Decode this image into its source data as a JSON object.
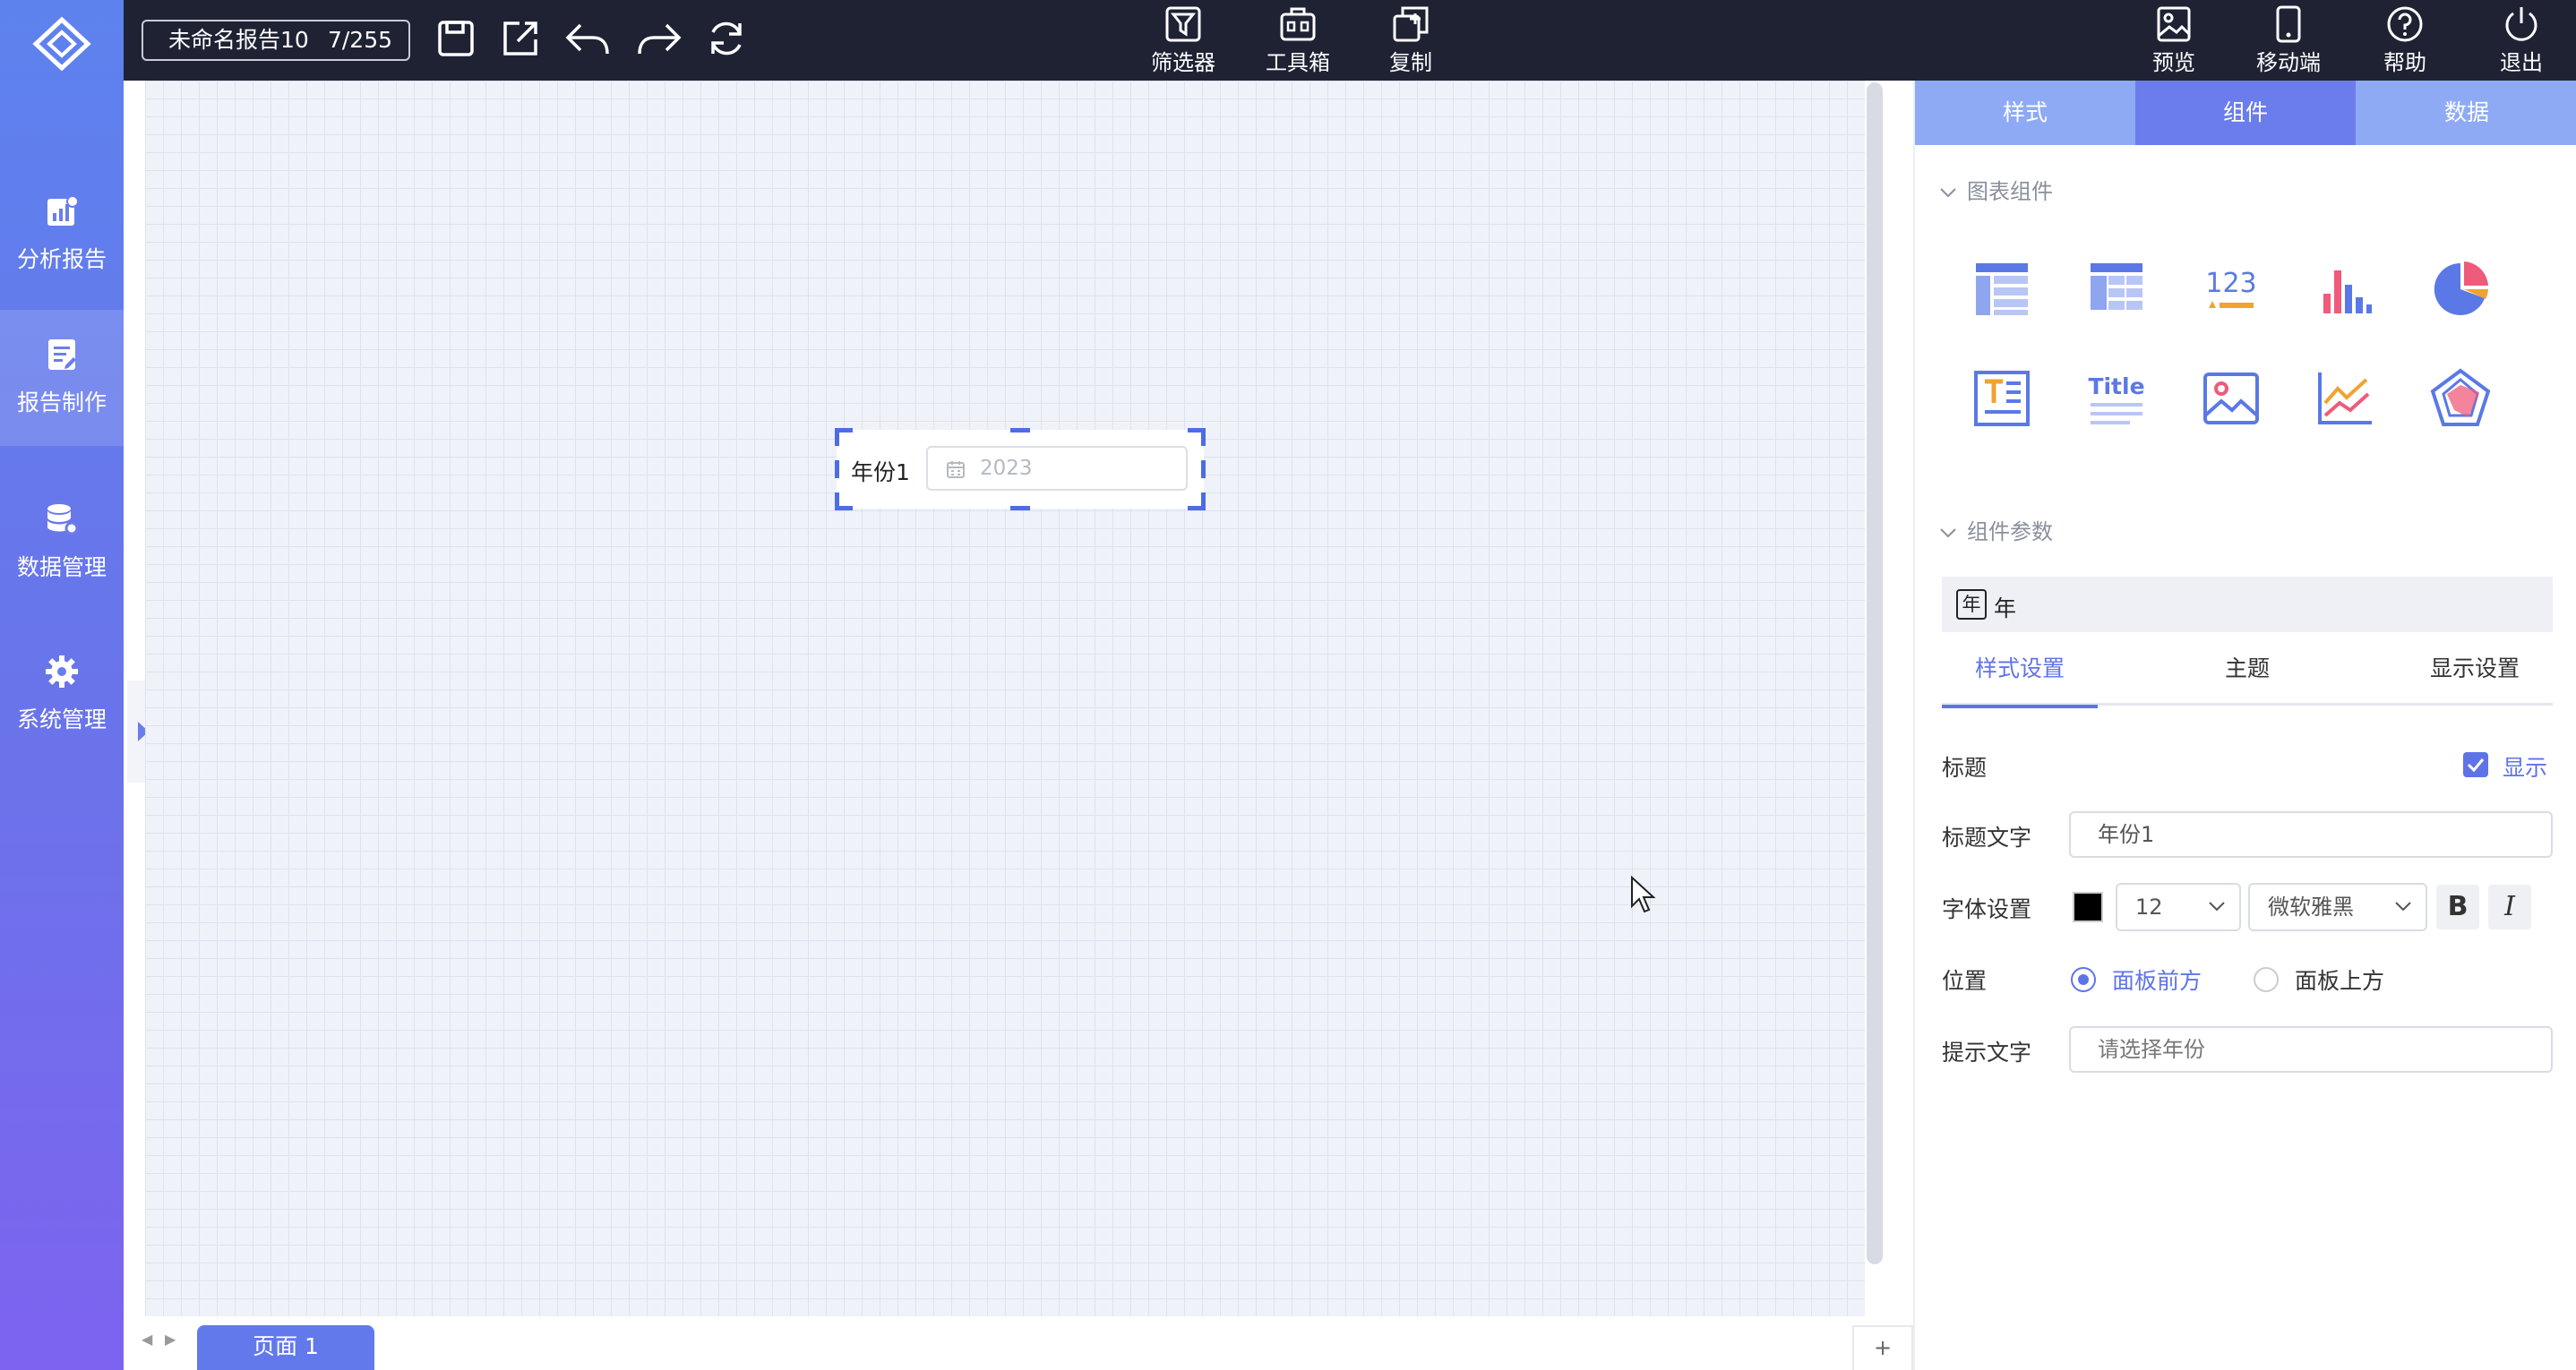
{
  "sidebar": {
    "items": [
      {
        "label": "分析报告",
        "icon": "report-chart-icon"
      },
      {
        "label": "报告制作",
        "icon": "edit-document-icon"
      },
      {
        "label": "数据管理",
        "icon": "database-icon"
      },
      {
        "label": "系统管理",
        "icon": "gear-icon"
      }
    ],
    "active_index": 1
  },
  "topbar": {
    "report_name": "未命名报告10",
    "report_count": "7/255",
    "center_buttons": [
      {
        "label": "筛选器",
        "icon": "filter-icon"
      },
      {
        "label": "工具箱",
        "icon": "toolbox-icon"
      },
      {
        "label": "复制",
        "icon": "copy-icon"
      }
    ],
    "right_buttons": [
      {
        "label": "预览",
        "icon": "preview-icon"
      },
      {
        "label": "移动端",
        "icon": "mobile-icon"
      },
      {
        "label": "帮助",
        "icon": "help-icon"
      },
      {
        "label": "退出",
        "icon": "power-icon"
      }
    ]
  },
  "canvas": {
    "widget": {
      "title": "年份1",
      "value": "2023"
    }
  },
  "bottombar": {
    "page_tab": "页面 1",
    "add_label": "+"
  },
  "panel": {
    "tabs": [
      "样式",
      "组件",
      "数据"
    ],
    "active_tab": 1,
    "chart_section_title": "图表组件",
    "params_section_title": "组件参数",
    "component_badge": "年",
    "component_name": "年",
    "subtabs": [
      "样式设置",
      "主题",
      "显示设置"
    ],
    "active_subtab": 0,
    "title_label": "标题",
    "show_label": "显示",
    "title_text_label": "标题文字",
    "title_text_value": "年份1",
    "font_label": "字体设置",
    "font_color": "#000000",
    "font_size": "12",
    "font_family": "微软雅黑",
    "bold_label": "B",
    "italic_label": "I",
    "position_label": "位置",
    "position_options": [
      "面板前方",
      "面板上方"
    ],
    "position_selected": 0,
    "hint_label": "提示文字",
    "hint_value": "请选择年份",
    "widget_icons": [
      "table-icon",
      "pivot-table-icon",
      "number-card-icon",
      "bar-chart-icon",
      "pie-chart-icon",
      "text-icon",
      "title-icon",
      "image-icon",
      "line-chart-icon",
      "radar-chart-icon"
    ],
    "number_icon_text": "123",
    "title_icon_text": "Title"
  },
  "colors": {
    "accent": "#5f73e8",
    "topbar": "#1e2233",
    "sidebar_top": "#5d82ee",
    "sidebar_bottom": "#7d63f0"
  }
}
